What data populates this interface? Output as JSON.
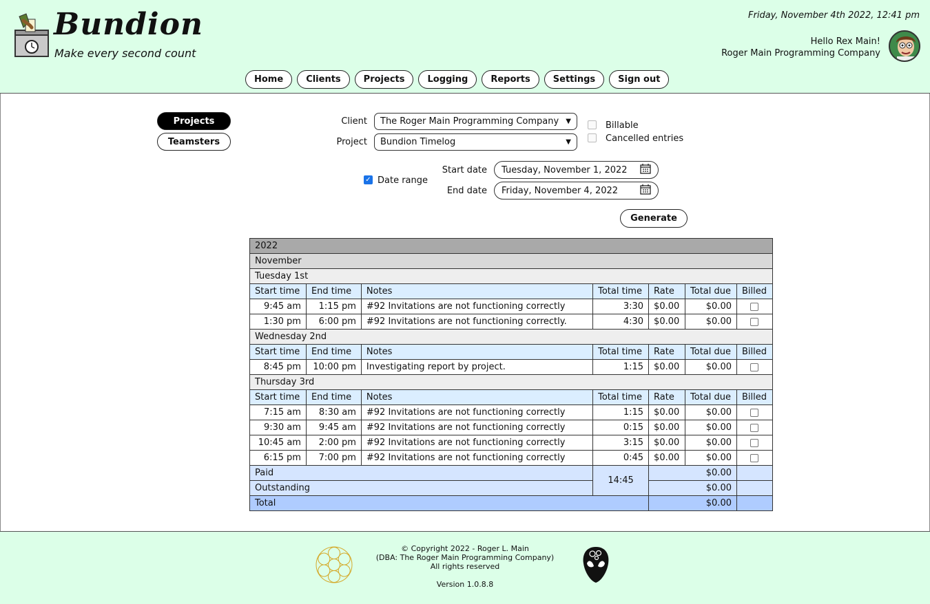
{
  "header": {
    "brand": "Bundion",
    "tagline": "Make every second count",
    "datetime": "Friday, November 4th 2022, 12:41 pm",
    "greeting": "Hello Rex Main!",
    "company": "Roger Main Programming Company"
  },
  "nav": [
    "Home",
    "Clients",
    "Projects",
    "Logging",
    "Reports",
    "Settings",
    "Sign out"
  ],
  "side_tabs": {
    "projects": "Projects",
    "teamsters": "Teamsters"
  },
  "filters": {
    "client_label": "Client",
    "client_value": "The Roger Main Programming Company",
    "project_label": "Project",
    "project_value": "Bundion Timelog",
    "billable_label": "Billable",
    "cancelled_label": "Cancelled entries",
    "date_range_label": "Date range",
    "start_label": "Start date",
    "start_value": "Tuesday, November 1, 2022",
    "end_label": "End date",
    "end_value": "Friday, November 4, 2022",
    "generate": "Generate"
  },
  "report": {
    "year": "2022",
    "month": "November",
    "columns": [
      "Start time",
      "End time",
      "Notes",
      "Total time",
      "Rate",
      "Total due",
      "Billed"
    ],
    "days": [
      {
        "label": "Tuesday 1st",
        "rows": [
          [
            "9:45 am",
            "1:15 pm",
            "#92 Invitations are not functioning correctly",
            "3:30",
            "$0.00",
            "$0.00"
          ],
          [
            "1:30 pm",
            "6:00 pm",
            "#92 Invitations are not functioning correctly.",
            "4:30",
            "$0.00",
            "$0.00"
          ]
        ]
      },
      {
        "label": "Wednesday 2nd",
        "rows": [
          [
            "8:45 pm",
            "10:00 pm",
            "Investigating report by project.",
            "1:15",
            "$0.00",
            "$0.00"
          ]
        ]
      },
      {
        "label": "Thursday 3rd",
        "rows": [
          [
            "7:15 am",
            "8:30 am",
            "#92 Invitations are not functioning correctly",
            "1:15",
            "$0.00",
            "$0.00"
          ],
          [
            "9:30 am",
            "9:45 am",
            "#92 Invitations are not functioning correctly",
            "0:15",
            "$0.00",
            "$0.00"
          ],
          [
            "10:45 am",
            "2:00 pm",
            "#92 Invitations are not functioning correctly",
            "3:15",
            "$0.00",
            "$0.00"
          ],
          [
            "6:15 pm",
            "7:00 pm",
            "#92 Invitations are not functioning correctly",
            "0:45",
            "$0.00",
            "$0.00"
          ]
        ]
      }
    ],
    "summary": {
      "paid_label": "Paid",
      "paid_value": "$0.00",
      "outstanding_label": "Outstanding",
      "outstanding_value": "$0.00",
      "total_time": "14:45",
      "total_label": "Total",
      "total_value": "$0.00"
    }
  },
  "footer": {
    "copyright_1": "© Copyright 2022 - Roger L. Main",
    "copyright_2": "(DBA: The Roger Main Programming Company)",
    "copyright_3": "All rights reserved",
    "version": "Version 1.0.8.8"
  },
  "colors": {
    "header_bg": "#dcffe8",
    "table_header_bg": "#dbeeff",
    "total_row_bg": "#afccff",
    "checkbox_accent": "#1a73e8"
  }
}
